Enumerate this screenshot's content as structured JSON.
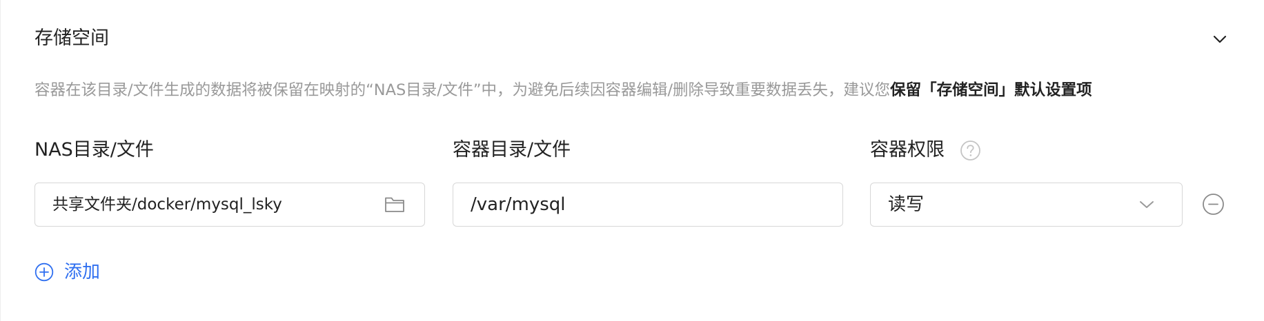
{
  "section": {
    "title": "存储空间",
    "collapse_icon": "chevron-down-icon"
  },
  "hint": {
    "text": "容器在该目录/文件生成的数据将被保留在映射的“NAS目录/文件”中，为避免后续因容器编辑/删除导致重要数据丢失，建议您",
    "emphasis": "保留「存储空间」默认设置项"
  },
  "columns": {
    "nas_label": "NAS目录/文件",
    "container_label": "容器目录/文件",
    "permission_label": "容器权限",
    "permission_help_icon": "question-circle-icon"
  },
  "rows": [
    {
      "nas_path": "共享文件夹/docker/mysql_lsky",
      "nas_browse_icon": "folder-icon",
      "container_path": "/var/mysql",
      "permission": "读写",
      "permission_dropdown_icon": "chevron-down-icon",
      "remove_icon": "minus-circle-icon"
    }
  ],
  "add": {
    "label": "添加",
    "icon": "plus-circle-icon"
  },
  "colors": {
    "accent": "#2f6ff0",
    "hint_text": "#999999",
    "border": "#d7d7d7",
    "icon_gray": "#8a8a8a"
  }
}
